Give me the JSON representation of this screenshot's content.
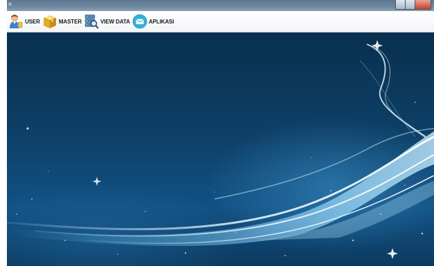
{
  "window": {
    "app_mark": "a"
  },
  "menu": {
    "items": [
      {
        "label": "USER",
        "icon": "user-icon"
      },
      {
        "label": "MASTER",
        "icon": "package-icon"
      },
      {
        "label": "VIEW DATA",
        "icon": "server-search-icon"
      },
      {
        "label": "APLIKASI",
        "icon": "mail-icon"
      }
    ]
  },
  "colors": {
    "desktop_base": "#0e4068",
    "wave_highlight": "#dff4ff",
    "menubar": "#ffffff",
    "close_button": "#c5412b"
  }
}
